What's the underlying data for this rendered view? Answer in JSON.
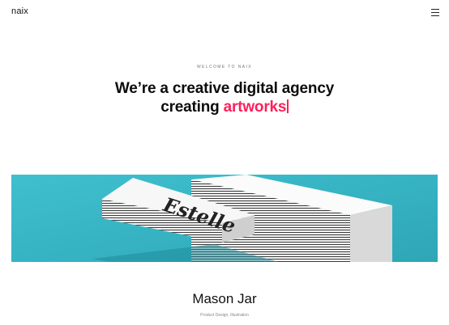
{
  "brand": {
    "logo": "naix"
  },
  "hero": {
    "eyebrow": "WELCOME TO NAIX",
    "line1": "We’re a creative digital agency",
    "line2_prefix": "creating ",
    "line2_accent": "artworks"
  },
  "showcase": {
    "card_text": "Estelle"
  },
  "project": {
    "title": "Mason Jar",
    "tags": "Product Design, Illustration"
  },
  "colors": {
    "accent": "#ff1f5a",
    "showcase_bg": "#35b6c6"
  },
  "icons": {
    "menu": "hamburger-menu-icon"
  }
}
